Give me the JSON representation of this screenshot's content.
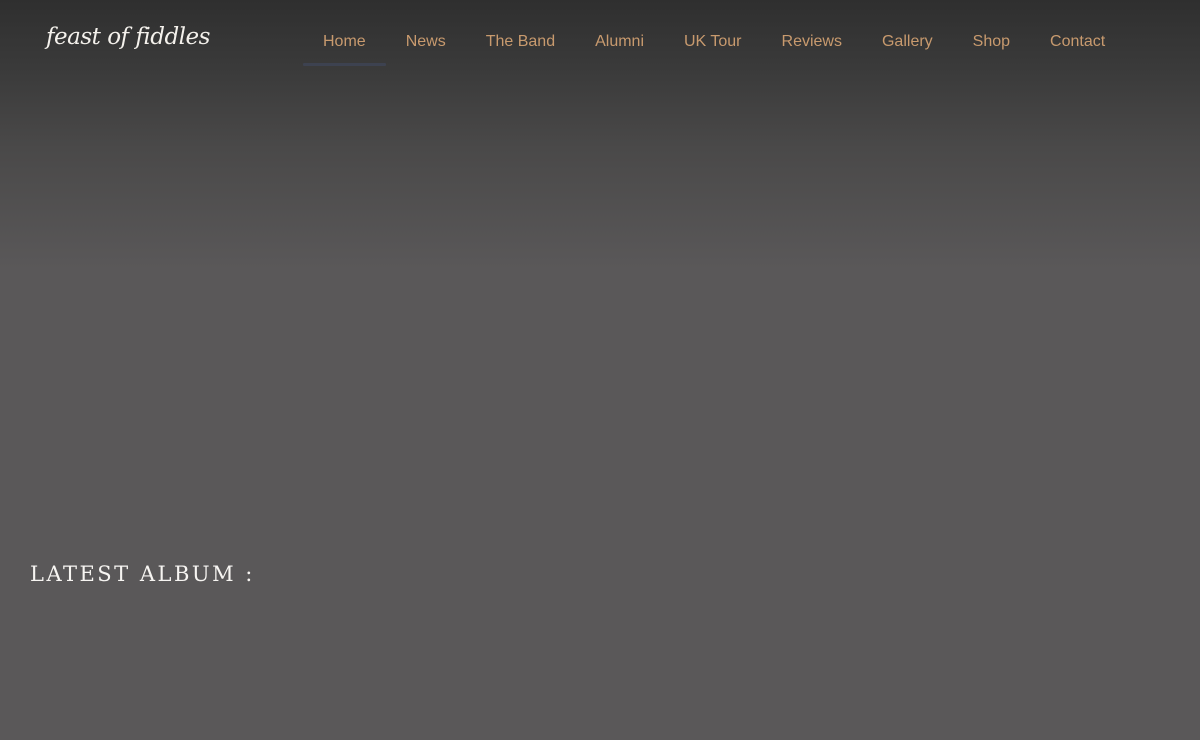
{
  "site": {
    "logo_text": "feast of fiddles"
  },
  "nav": {
    "active": "Home",
    "items": [
      {
        "label": "Home"
      },
      {
        "label": "News"
      },
      {
        "label": "The Band"
      },
      {
        "label": "Alumni"
      },
      {
        "label": "UK Tour"
      },
      {
        "label": "Reviews"
      },
      {
        "label": "Gallery"
      },
      {
        "label": "Shop"
      },
      {
        "label": "Contact"
      }
    ]
  },
  "main": {
    "section_heading": "LATEST ALBUM :"
  },
  "colors": {
    "nav_text": "#c89a6e",
    "active_indicator": "#3d4250",
    "background": "#5a5859",
    "heading_text": "#f7f5f2"
  }
}
